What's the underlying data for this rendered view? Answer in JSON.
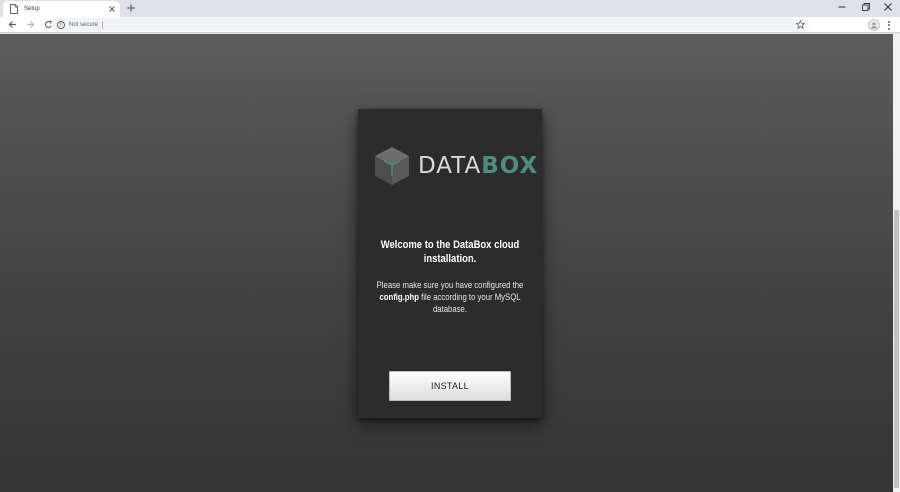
{
  "browser": {
    "tab": {
      "title": "Setup"
    },
    "address_bar": {
      "security_label": "Not secure",
      "url": ""
    }
  },
  "card": {
    "logo": {
      "word_light": "DATA",
      "word_bold": "BOX"
    },
    "heading": "Welcome to the DataBox cloud installation.",
    "body_before": "Please make sure you have configured the",
    "body_bold": "config.php",
    "body_after": "file according to your MySQL database.",
    "install_label": "INSTALL"
  },
  "colors": {
    "brand_accent": "#4f8c7e",
    "card_background": "#2c2c2c",
    "page_background": "#4b4b4b"
  },
  "icons": [
    "page-favicon-icon",
    "close-icon",
    "plus-icon",
    "minimize-icon",
    "restore-icon",
    "back-arrow-icon",
    "forward-arrow-icon",
    "reload-icon",
    "info-icon",
    "star-icon",
    "profile-icon",
    "kebab-menu-icon",
    "cube-logo-icon"
  ]
}
